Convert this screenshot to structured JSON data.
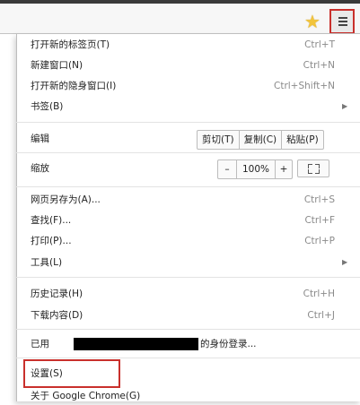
{
  "toolbar": {
    "bookmark_icon": "star-icon",
    "menu_icon": "hamburger-menu-icon",
    "highlight_color": "#c9302c"
  },
  "menu": {
    "new_tab": {
      "label": "打开新的标签页(T)",
      "shortcut": "Ctrl+T"
    },
    "new_window": {
      "label": "新建窗口(N)",
      "shortcut": "Ctrl+N"
    },
    "new_incognito": {
      "label": "打开新的隐身窗口(I)",
      "shortcut": "Ctrl+Shift+N"
    },
    "bookmarks": {
      "label": "书签(B)"
    },
    "edit": {
      "label": "编辑",
      "cut": "剪切(T)",
      "copy": "复制(C)",
      "paste": "粘贴(P)"
    },
    "zoom": {
      "label": "缩放",
      "minus": "–",
      "value": "100%",
      "plus": "+"
    },
    "save_as": {
      "label": "网页另存为(A)...",
      "shortcut": "Ctrl+S"
    },
    "find": {
      "label": "查找(F)...",
      "shortcut": "Ctrl+F"
    },
    "print": {
      "label": "打印(P)...",
      "shortcut": "Ctrl+P"
    },
    "tools": {
      "label": "工具(L)"
    },
    "history": {
      "label": "历史记录(H)",
      "shortcut": "Ctrl+H"
    },
    "downloads": {
      "label": "下载内容(D)",
      "shortcut": "Ctrl+J"
    },
    "signin": {
      "prefix": "已用",
      "suffix": "的身份登录..."
    },
    "settings": {
      "label": "设置(S)"
    },
    "about": {
      "label": "关于 Google Chrome(G)"
    }
  }
}
